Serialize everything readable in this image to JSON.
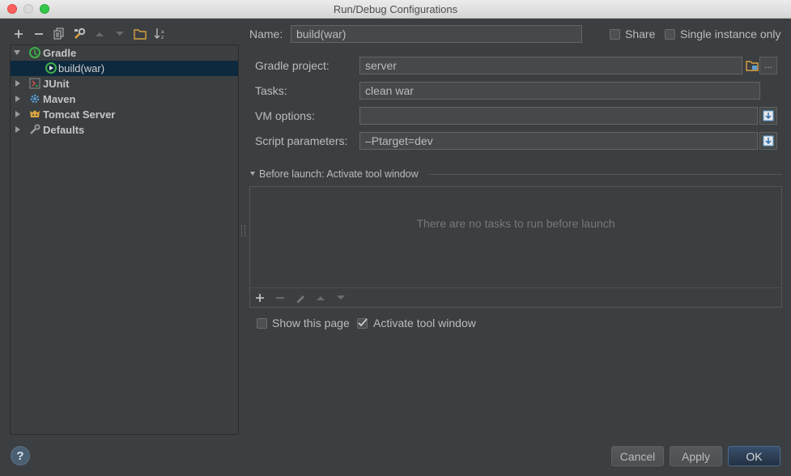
{
  "window": {
    "title": "Run/Debug Configurations"
  },
  "tree": {
    "items": [
      {
        "label": "Gradle",
        "expanded": true,
        "icon": "gradle-icon"
      },
      {
        "label": "build(war)",
        "icon": "gradle-config-icon",
        "selected": true
      },
      {
        "label": "JUnit",
        "icon": "junit-icon"
      },
      {
        "label": "Maven",
        "icon": "maven-icon"
      },
      {
        "label": "Tomcat Server",
        "icon": "tomcat-icon"
      },
      {
        "label": "Defaults",
        "icon": "wrench-icon"
      }
    ]
  },
  "form": {
    "name_label": "Name:",
    "name_value": "build(war)",
    "share_label": "Share",
    "single_instance_label": "Single instance only",
    "gradle_project_label": "Gradle project:",
    "gradle_project_value": "server",
    "tasks_label": "Tasks:",
    "tasks_value": "clean war",
    "vm_options_label": "VM options:",
    "vm_options_value": "",
    "script_params_label": "Script parameters:",
    "script_params_value": "–Ptarget=dev",
    "ellipsis": "..."
  },
  "before_launch": {
    "title": "Before launch: Activate tool window",
    "empty_text": "There are no tasks to run before launch",
    "show_page_label": "Show this page",
    "activate_tool_window_label": "Activate tool window",
    "activate_checked": true,
    "show_page_checked": false
  },
  "footer": {
    "help": "?",
    "cancel": "Cancel",
    "apply": "Apply",
    "ok": "OK"
  },
  "colors": {
    "selection": "#0d293e",
    "gradle_green": "#3db049",
    "folder_yellow": "#d9a441"
  }
}
